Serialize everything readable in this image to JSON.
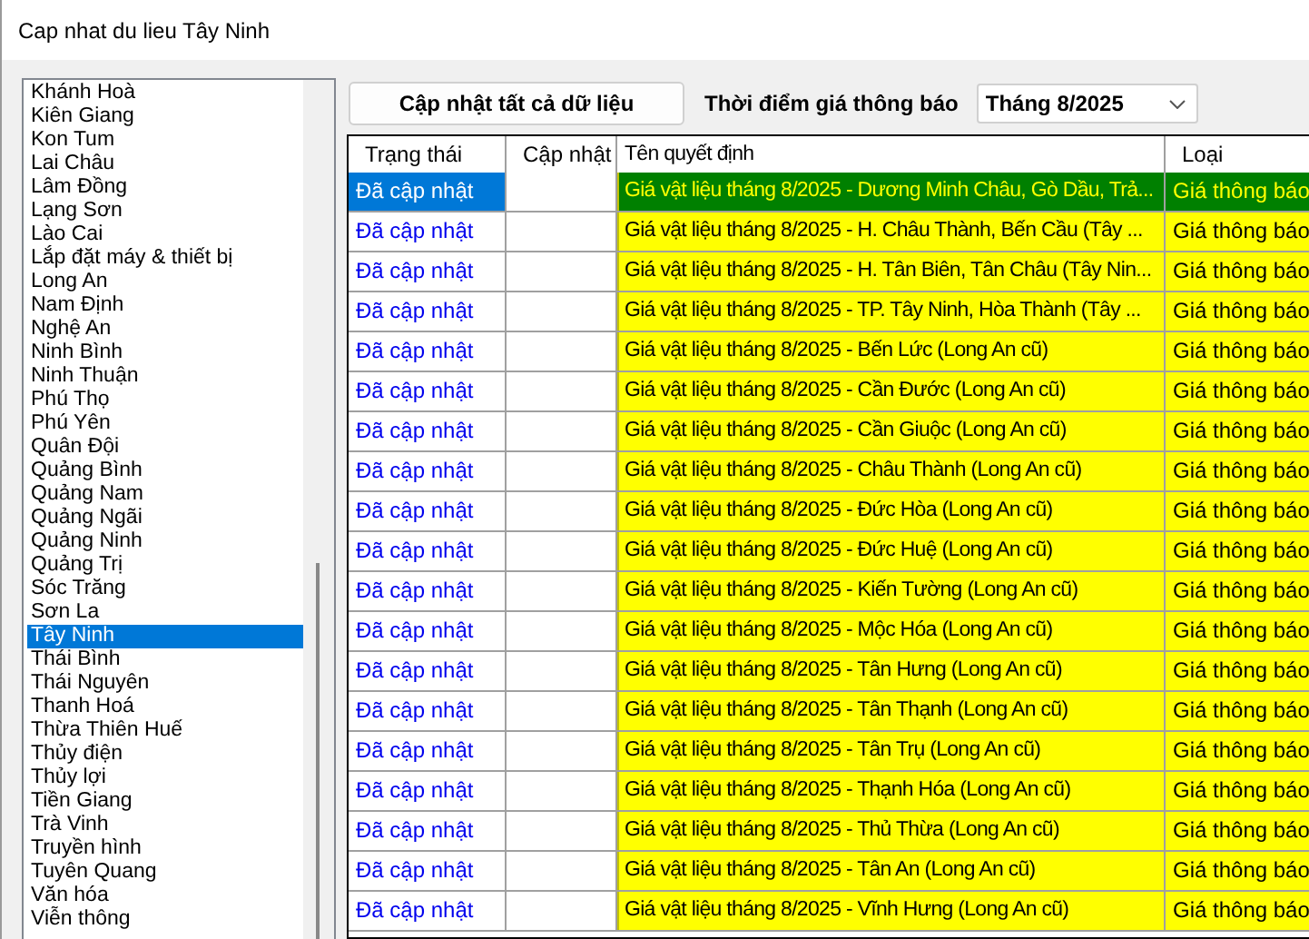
{
  "window": {
    "title": "Cap nhat du lieu Tây Ninh"
  },
  "province_list": [
    {
      "label": "Khánh Hoà",
      "selected": false
    },
    {
      "label": "Kiên Giang",
      "selected": false
    },
    {
      "label": "Kon Tum",
      "selected": false
    },
    {
      "label": "Lai Châu",
      "selected": false
    },
    {
      "label": "Lâm Đồng",
      "selected": false
    },
    {
      "label": "Lạng Sơn",
      "selected": false
    },
    {
      "label": "Lào Cai",
      "selected": false
    },
    {
      "label": "Lắp đặt máy & thiết bị",
      "selected": false
    },
    {
      "label": "Long An",
      "selected": false
    },
    {
      "label": "Nam Định",
      "selected": false
    },
    {
      "label": "Nghệ An",
      "selected": false
    },
    {
      "label": "Ninh Bình",
      "selected": false
    },
    {
      "label": "Ninh Thuận",
      "selected": false
    },
    {
      "label": "Phú Thọ",
      "selected": false
    },
    {
      "label": "Phú Yên",
      "selected": false
    },
    {
      "label": "Quân Đội",
      "selected": false
    },
    {
      "label": "Quảng Bình",
      "selected": false
    },
    {
      "label": "Quảng Nam",
      "selected": false
    },
    {
      "label": "Quảng Ngãi",
      "selected": false
    },
    {
      "label": "Quảng Ninh",
      "selected": false
    },
    {
      "label": "Quảng Trị",
      "selected": false
    },
    {
      "label": "Sóc Trăng",
      "selected": false
    },
    {
      "label": "Sơn La",
      "selected": false
    },
    {
      "label": "Tây Ninh",
      "selected": true
    },
    {
      "label": "Thái Bình",
      "selected": false
    },
    {
      "label": "Thái Nguyên",
      "selected": false
    },
    {
      "label": "Thanh Hoá",
      "selected": false
    },
    {
      "label": "Thừa Thiên Huế",
      "selected": false
    },
    {
      "label": "Thủy điện",
      "selected": false
    },
    {
      "label": "Thủy lợi",
      "selected": false
    },
    {
      "label": "Tiền Giang",
      "selected": false
    },
    {
      "label": "Trà Vinh",
      "selected": false
    },
    {
      "label": "Truyền hình",
      "selected": false
    },
    {
      "label": "Tuyên Quang",
      "selected": false
    },
    {
      "label": "Văn hóa",
      "selected": false
    },
    {
      "label": "Viễn thông",
      "selected": false
    }
  ],
  "update_all_button": "Cập nhật tất cả dữ liệu",
  "period": {
    "label": "Thời điểm giá thông báo",
    "value": "Tháng 8/2025"
  },
  "table": {
    "columns": [
      "Trạng thái",
      "Cập nhật",
      "Tên quyết định",
      "Loại"
    ],
    "rows": [
      {
        "status": "Đã cập nhật",
        "name": "Giá vật liệu tháng 8/2025 - Dương Minh Châu, Gò Dầu, Trả...",
        "type": "Giá thông báo",
        "selected": true
      },
      {
        "status": "Đã cập nhật",
        "name": "Giá vật liệu tháng 8/2025 - H. Châu Thành, Bến Cầu (Tây ...",
        "type": "Giá thông báo",
        "selected": false
      },
      {
        "status": "Đã cập nhật",
        "name": "Giá vật liệu tháng 8/2025 - H. Tân Biên, Tân Châu (Tây Nin...",
        "type": "Giá thông báo",
        "selected": false
      },
      {
        "status": "Đã cập nhật",
        "name": "Giá vật liệu tháng 8/2025 - TP. Tây Ninh, Hòa Thành (Tây ...",
        "type": "Giá thông báo",
        "selected": false
      },
      {
        "status": "Đã cập nhật",
        "name": "Giá vật liệu tháng 8/2025 - Bến Lức (Long An cũ)",
        "type": "Giá thông báo",
        "selected": false
      },
      {
        "status": "Đã cập nhật",
        "name": "Giá vật liệu tháng 8/2025 - Cần Đước (Long An cũ)",
        "type": "Giá thông báo",
        "selected": false
      },
      {
        "status": "Đã cập nhật",
        "name": "Giá vật liệu tháng 8/2025 - Cần Giuộc (Long An cũ)",
        "type": "Giá thông báo",
        "selected": false
      },
      {
        "status": "Đã cập nhật",
        "name": "Giá vật liệu tháng 8/2025 - Châu Thành (Long An cũ)",
        "type": "Giá thông báo",
        "selected": false
      },
      {
        "status": "Đã cập nhật",
        "name": "Giá vật liệu tháng 8/2025 - Đức Hòa (Long An cũ)",
        "type": "Giá thông báo",
        "selected": false
      },
      {
        "status": "Đã cập nhật",
        "name": "Giá vật liệu tháng 8/2025 - Đức Huệ (Long An cũ)",
        "type": "Giá thông báo",
        "selected": false
      },
      {
        "status": "Đã cập nhật",
        "name": "Giá vật liệu tháng 8/2025 - Kiến Tường (Long An cũ)",
        "type": "Giá thông báo",
        "selected": false
      },
      {
        "status": "Đã cập nhật",
        "name": "Giá vật liệu tháng 8/2025 - Mộc Hóa (Long An cũ)",
        "type": "Giá thông báo",
        "selected": false
      },
      {
        "status": "Đã cập nhật",
        "name": "Giá vật liệu tháng 8/2025 - Tân Hưng (Long An cũ)",
        "type": "Giá thông báo",
        "selected": false
      },
      {
        "status": "Đã cập nhật",
        "name": "Giá vật liệu tháng 8/2025 - Tân Thạnh (Long An cũ)",
        "type": "Giá thông báo",
        "selected": false
      },
      {
        "status": "Đã cập nhật",
        "name": "Giá vật liệu tháng 8/2025 - Tân Trụ (Long An cũ)",
        "type": "Giá thông báo",
        "selected": false
      },
      {
        "status": "Đã cập nhật",
        "name": "Giá vật liệu tháng 8/2025 - Thạnh Hóa (Long An cũ)",
        "type": "Giá thông báo",
        "selected": false
      },
      {
        "status": "Đã cập nhật",
        "name": "Giá vật liệu tháng 8/2025 - Thủ Thừa (Long An cũ)",
        "type": "Giá thông báo",
        "selected": false
      },
      {
        "status": "Đã cập nhật",
        "name": "Giá vật liệu tháng 8/2025 - Tân An (Long An cũ)",
        "type": "Giá thông báo",
        "selected": false
      },
      {
        "status": "Đã cập nhật",
        "name": "Giá vật liệu tháng 8/2025 - Vĩnh Hưng (Long An cũ)",
        "type": "Giá thông báo",
        "selected": false
      }
    ]
  }
}
